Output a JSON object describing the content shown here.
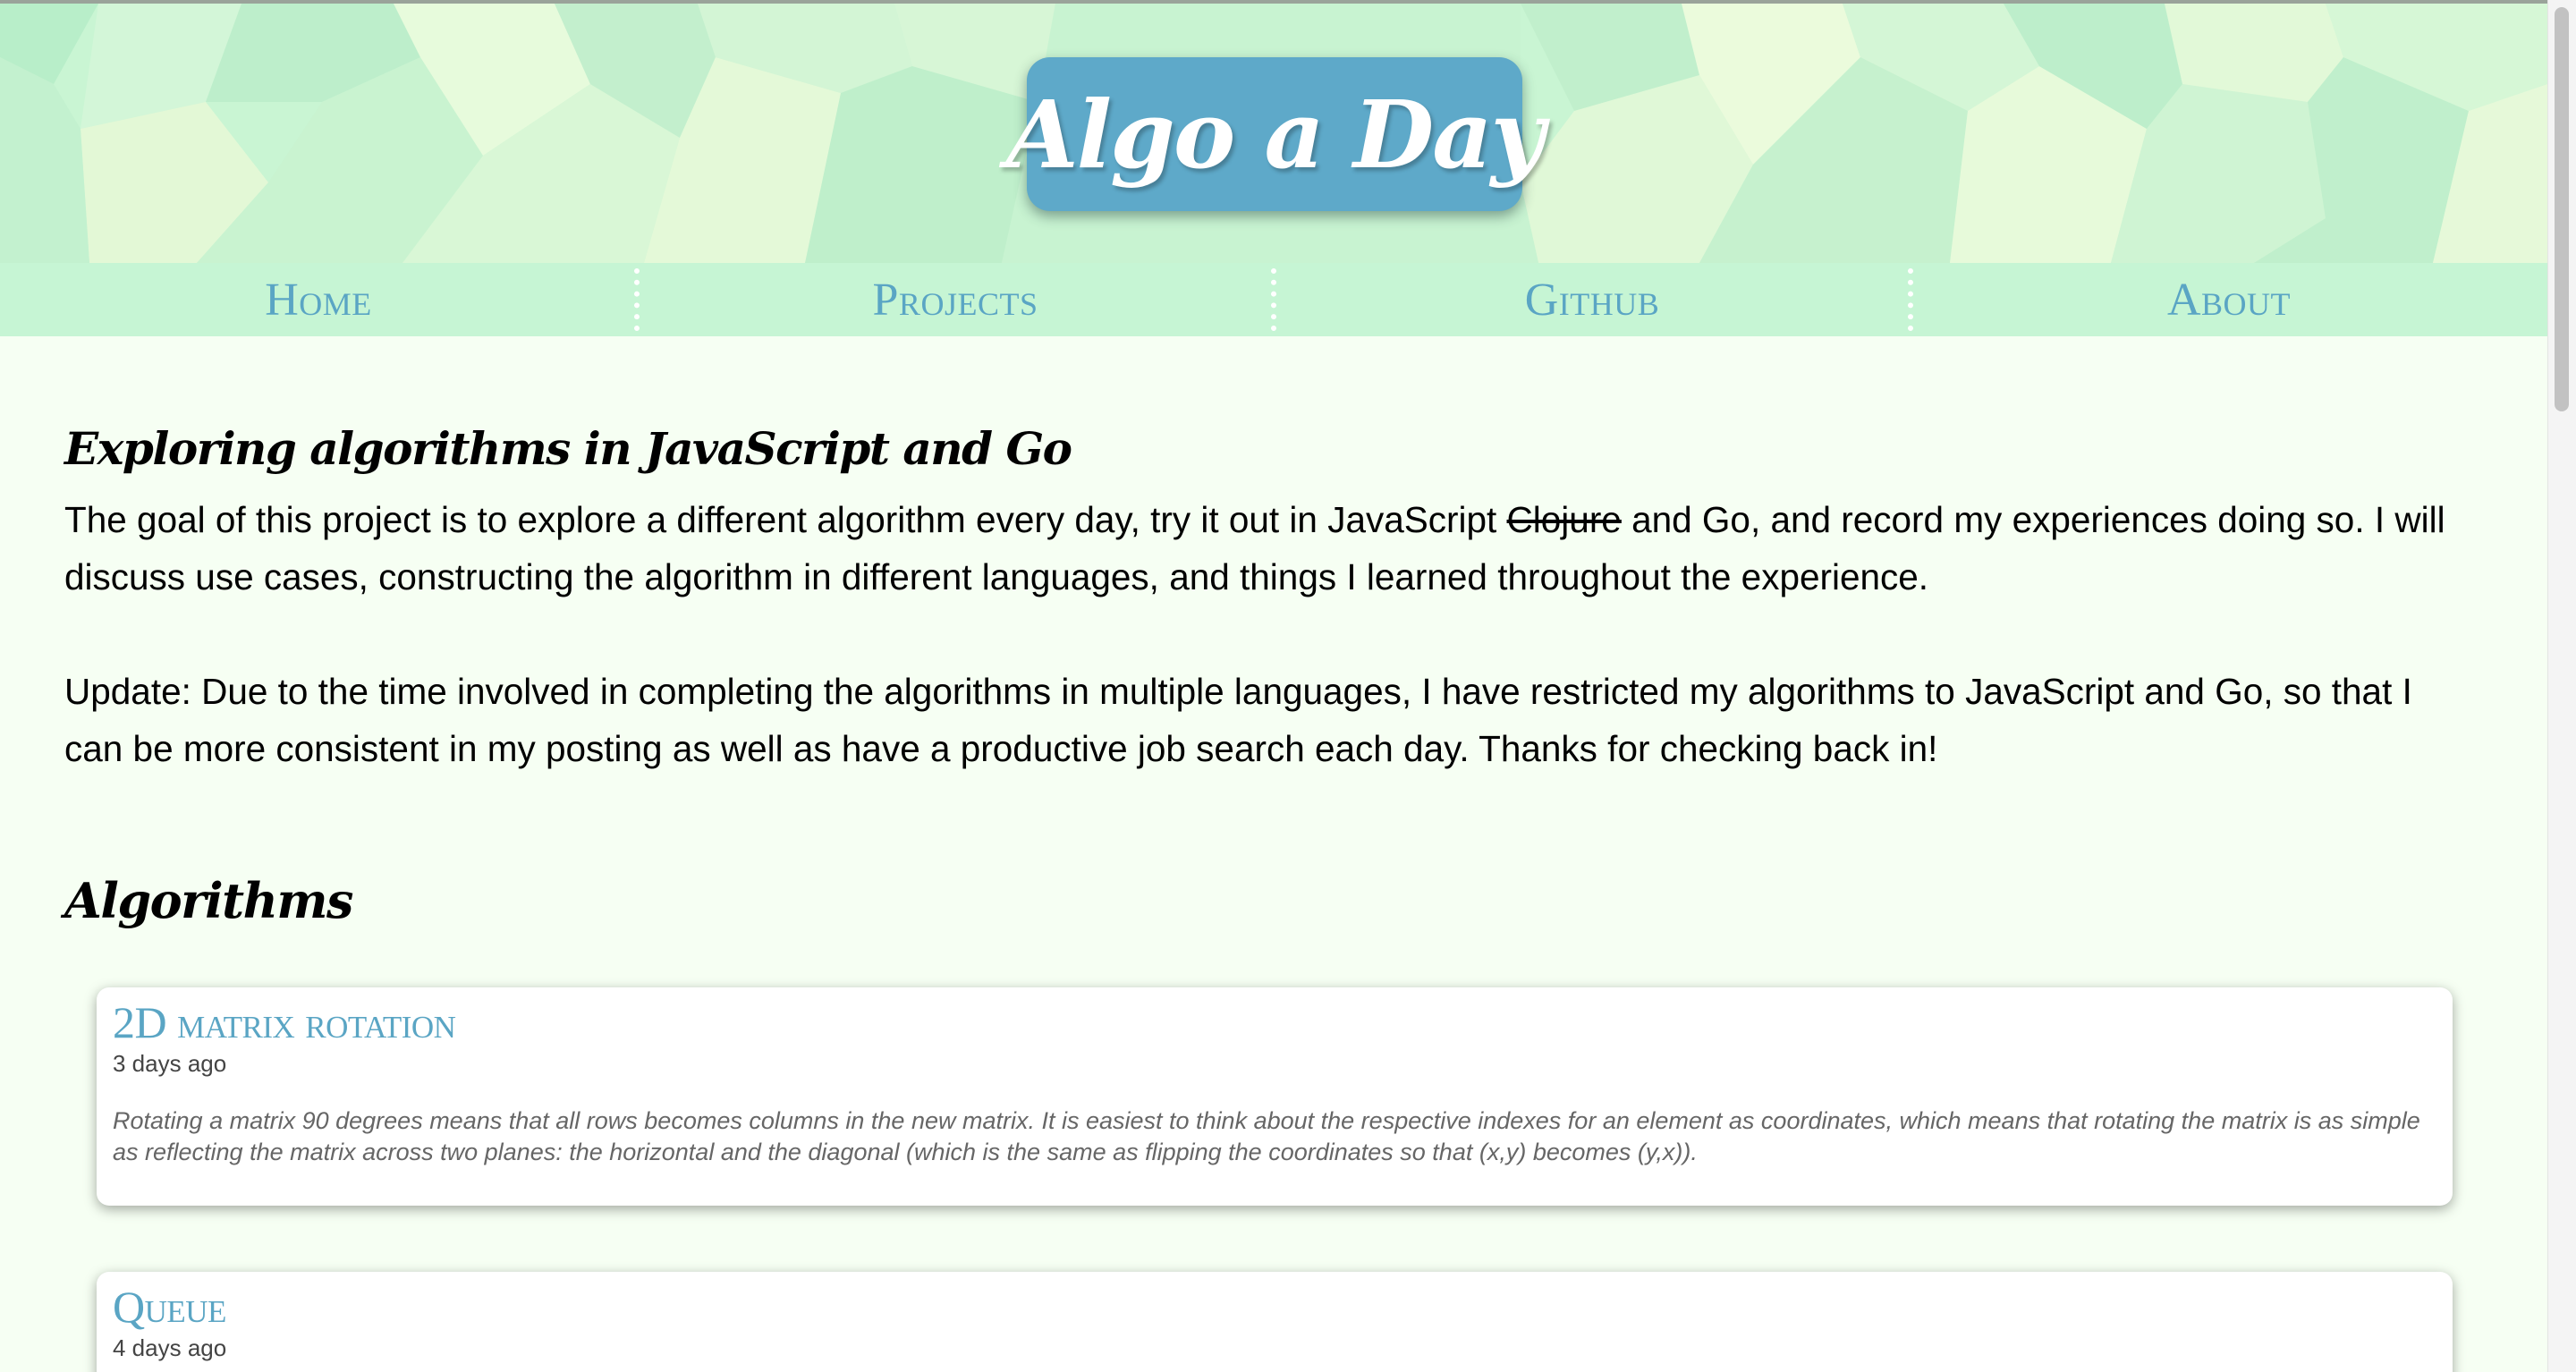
{
  "site": {
    "title": "Algo a Day"
  },
  "nav": {
    "items": [
      {
        "label": "Home"
      },
      {
        "label": "Projects"
      },
      {
        "label": "Github"
      },
      {
        "label": "About"
      }
    ]
  },
  "intro": {
    "heading": "Exploring algorithms in JavaScript and Go",
    "paragraph_1_before": "The goal of this project is to explore a different algorithm every day, try it out in JavaScript ",
    "paragraph_1_struck": "Clojure",
    "paragraph_1_after": " and Go, and record my experiences doing so. I will discuss use cases, constructing the algorithm in different languages, and things I learned throughout the experience.",
    "paragraph_2": "Update: Due to the time involved in completing the algorithms in multiple languages, I have restricted my algorithms to JavaScript and Go, so that I can be more consistent in my posting as well as have a productive job search each day. Thanks for checking back in!"
  },
  "algorithms": {
    "heading": "Algorithms",
    "cards": [
      {
        "title": "2D matrix rotation",
        "date": "3 days ago",
        "summary": "Rotating a matrix 90 degrees means that all rows becomes columns in the new matrix. It is easiest to think about the respective indexes for an element as coordinates, which means that rotating the matrix is as simple as reflecting the matrix across two planes: the horizontal and the diagonal (which is the same as flipping the coordinates so that (x,y) becomes (y,x))."
      },
      {
        "title": "Queue",
        "date": "4 days ago"
      }
    ]
  },
  "colors": {
    "accent": "#5ea9c9",
    "nav_bg": "#c6f5d4",
    "page_bg": "#f6fff3"
  }
}
